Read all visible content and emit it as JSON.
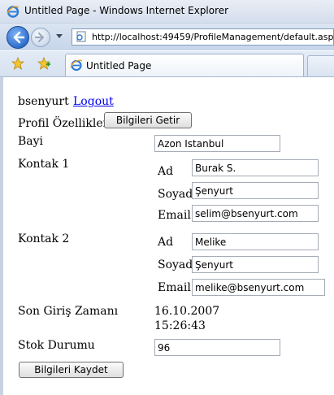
{
  "window": {
    "title": "Untitled Page - Windows Internet Explorer"
  },
  "address_bar": {
    "url": "http://localhost:49459/ProfileManagement/default.aspx"
  },
  "tab": {
    "label": "Untitled Page"
  },
  "icons": {
    "browser": "internet-explorer-logo-icon",
    "back": "back-arrow-icon",
    "forward": "forward-arrow-icon",
    "favorites": "favorites-star-icon",
    "add_favorite": "add-to-favorites-icon"
  },
  "colors": {
    "link": "#0000ee",
    "chrome": "#d4deec"
  },
  "login": {
    "user_name": "bsenyurt",
    "logout_link": "Logout"
  },
  "profile": {
    "properties_label": "Profil Özellikleri",
    "fetch_button": "Bilgileri Getir",
    "dealer_label": "Bayi",
    "dealer_value": "Azon Istanbul",
    "contact1_label": "Kontak 1",
    "contact1": {
      "name_label": "Ad",
      "name_value": "Burak S.",
      "surname_label": "Soyad",
      "surname_value": "Şenyurt",
      "email_label": "Email",
      "email_value": "selim@bsenyurt.com"
    },
    "contact2_label": "Kontak 2",
    "contact2": {
      "name_label": "Ad",
      "name_value": "Melike",
      "surname_label": "Soyad",
      "surname_value": "Şenyurt",
      "email_label": "Email",
      "email_value": "melike@bsenyurt.com"
    },
    "last_login_label": "Son Giriş Zamanı",
    "last_login_date": "16.10.2007",
    "last_login_time": "15:26:43",
    "stock_label": "Stok Durumu",
    "stock_value": "96",
    "save_button": "Bilgileri Kaydet"
  }
}
